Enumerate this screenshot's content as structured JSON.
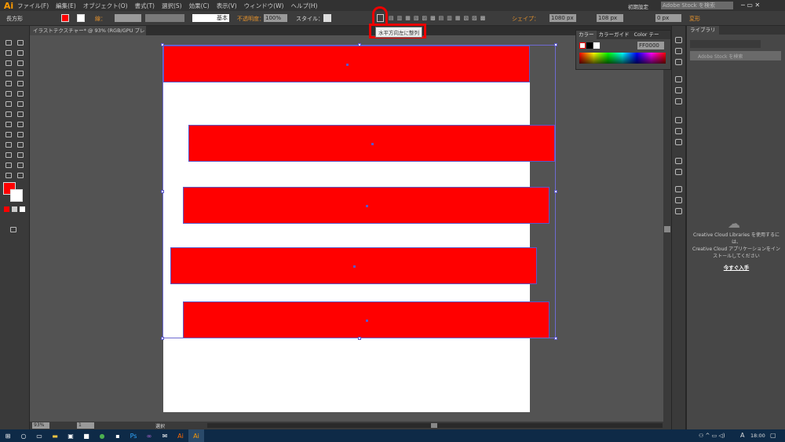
{
  "app": {
    "logo": "Ai"
  },
  "menu": [
    "ファイル(F)",
    "編集(E)",
    "オブジェクト(O)",
    "書式(T)",
    "選択(S)",
    "効果(C)",
    "表示(V)",
    "ウィンドウ(W)",
    "ヘルプ(H)"
  ],
  "workspace": "初期設定",
  "stock_search": {
    "placeholder": "Adobe Stock を検索"
  },
  "options": {
    "object_type": "長方形",
    "stroke_label": "線：",
    "stroke_style": "基本",
    "opacity_label": "不透明度：",
    "opacity": "100%",
    "style_label": "スタイル：",
    "shape_label": "シェイプ：",
    "width": "1080 px",
    "height": "108 px",
    "corner": "0 px",
    "transform_label": "変形"
  },
  "tooltip": "水平方向左に整列",
  "document": {
    "tab": "イラストテクスチャー* @ 93% (RGB/GPU プレビュー)",
    "zoom": "93%",
    "page": "1",
    "status": "選択"
  },
  "color_panel": {
    "tabs": [
      "カラー",
      "カラーガイド",
      "Color テー"
    ],
    "hex": "FF0000"
  },
  "library": {
    "tab": "ライブラリ",
    "search_placeholder": "Adobe Stock を検索",
    "message1": "Creative Cloud Libraries を使用するには、",
    "message2": "Creative Cloud アプリケーションをインストールしてください",
    "install": "今すぐ入手"
  },
  "taskbar": {
    "time": "18:00",
    "ime": "A"
  },
  "colors": {
    "fill": "#ff0000",
    "selection": "#5a57c9"
  }
}
